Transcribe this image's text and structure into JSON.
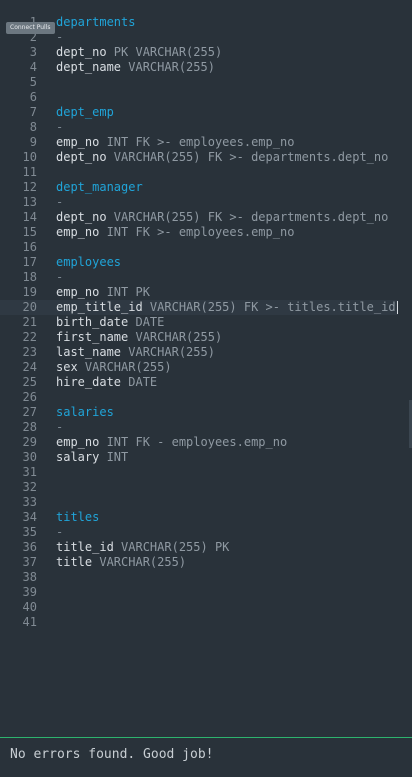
{
  "editor": {
    "connect_tag": "Connect Pulls",
    "active_line": 20,
    "lines": [
      {
        "num": "1",
        "tokens": [
          {
            "t": "departments",
            "c": "table"
          }
        ]
      },
      {
        "num": "2",
        "tokens": [
          {
            "t": "-",
            "c": "dash"
          }
        ]
      },
      {
        "num": "3",
        "tokens": [
          {
            "t": "dept_no",
            "c": "field"
          },
          {
            "t": " PK VARCHAR(255)",
            "c": "type"
          }
        ]
      },
      {
        "num": "4",
        "tokens": [
          {
            "t": "dept_name",
            "c": "field"
          },
          {
            "t": " VARCHAR(255)",
            "c": "type"
          }
        ]
      },
      {
        "num": "5",
        "tokens": []
      },
      {
        "num": "6",
        "tokens": []
      },
      {
        "num": "7",
        "tokens": [
          {
            "t": "dept_emp",
            "c": "table"
          }
        ]
      },
      {
        "num": "8",
        "tokens": [
          {
            "t": "-",
            "c": "dash"
          }
        ]
      },
      {
        "num": "9",
        "tokens": [
          {
            "t": "emp_no",
            "c": "field"
          },
          {
            "t": " INT FK >- employees.emp_no",
            "c": "type"
          }
        ]
      },
      {
        "num": "10",
        "tokens": [
          {
            "t": "dept_no",
            "c": "field"
          },
          {
            "t": " VARCHAR(255) FK >- departments.dept_no",
            "c": "type"
          }
        ]
      },
      {
        "num": "11",
        "tokens": []
      },
      {
        "num": "12",
        "tokens": [
          {
            "t": "dept_manager",
            "c": "table"
          }
        ]
      },
      {
        "num": "13",
        "tokens": [
          {
            "t": "-",
            "c": "dash"
          }
        ]
      },
      {
        "num": "14",
        "tokens": [
          {
            "t": "dept_no",
            "c": "field"
          },
          {
            "t": " VARCHAR(255) FK >- departments.dept_no",
            "c": "type"
          }
        ]
      },
      {
        "num": "15",
        "tokens": [
          {
            "t": "emp_no",
            "c": "field"
          },
          {
            "t": " INT FK >- employees.emp_no",
            "c": "type"
          }
        ]
      },
      {
        "num": "16",
        "tokens": []
      },
      {
        "num": "17",
        "tokens": [
          {
            "t": "employees",
            "c": "table"
          }
        ]
      },
      {
        "num": "18",
        "tokens": [
          {
            "t": "-",
            "c": "dash"
          }
        ]
      },
      {
        "num": "19",
        "tokens": [
          {
            "t": "emp_no",
            "c": "field"
          },
          {
            "t": " INT PK",
            "c": "type"
          }
        ]
      },
      {
        "num": "20",
        "tokens": [
          {
            "t": "emp_title_id",
            "c": "field"
          },
          {
            "t": " VARCHAR(255) FK >- titles.title_id",
            "c": "type"
          }
        ]
      },
      {
        "num": "21",
        "tokens": [
          {
            "t": "birth_date",
            "c": "field"
          },
          {
            "t": " DATE",
            "c": "type"
          }
        ]
      },
      {
        "num": "22",
        "tokens": [
          {
            "t": "first_name",
            "c": "field"
          },
          {
            "t": " VARCHAR(255)",
            "c": "type"
          }
        ]
      },
      {
        "num": "23",
        "tokens": [
          {
            "t": "last_name",
            "c": "field"
          },
          {
            "t": " VARCHAR(255)",
            "c": "type"
          }
        ]
      },
      {
        "num": "24",
        "tokens": [
          {
            "t": "sex",
            "c": "field"
          },
          {
            "t": " VARCHAR(255)",
            "c": "type"
          }
        ]
      },
      {
        "num": "25",
        "tokens": [
          {
            "t": "hire_date",
            "c": "field"
          },
          {
            "t": " DATE",
            "c": "type"
          }
        ]
      },
      {
        "num": "26",
        "tokens": []
      },
      {
        "num": "27",
        "tokens": [
          {
            "t": "salaries",
            "c": "table"
          }
        ]
      },
      {
        "num": "28",
        "tokens": [
          {
            "t": "-",
            "c": "dash"
          }
        ]
      },
      {
        "num": "29",
        "tokens": [
          {
            "t": "emp_no",
            "c": "field"
          },
          {
            "t": " INT FK - employees.emp_no",
            "c": "type"
          }
        ]
      },
      {
        "num": "30",
        "tokens": [
          {
            "t": "salary",
            "c": "field"
          },
          {
            "t": " INT",
            "c": "type"
          }
        ]
      },
      {
        "num": "31",
        "tokens": []
      },
      {
        "num": "32",
        "tokens": []
      },
      {
        "num": "33",
        "tokens": []
      },
      {
        "num": "34",
        "tokens": [
          {
            "t": "titles",
            "c": "table"
          }
        ]
      },
      {
        "num": "35",
        "tokens": [
          {
            "t": "-",
            "c": "dash"
          }
        ]
      },
      {
        "num": "36",
        "tokens": [
          {
            "t": "title_id",
            "c": "field"
          },
          {
            "t": " VARCHAR(255) PK",
            "c": "type"
          }
        ]
      },
      {
        "num": "37",
        "tokens": [
          {
            "t": "title",
            "c": "field"
          },
          {
            "t": " VARCHAR(255)",
            "c": "type"
          }
        ]
      },
      {
        "num": "38",
        "tokens": []
      },
      {
        "num": "39",
        "tokens": []
      },
      {
        "num": "40",
        "tokens": []
      },
      {
        "num": "41",
        "tokens": []
      }
    ]
  },
  "status": {
    "message": "No errors found. Good job!",
    "accent_color": "#2db36e"
  },
  "colors": {
    "background": "#29323a",
    "table_name": "#20a4d8",
    "field_name": "#d8dde2",
    "type_text": "#8f99a2"
  }
}
